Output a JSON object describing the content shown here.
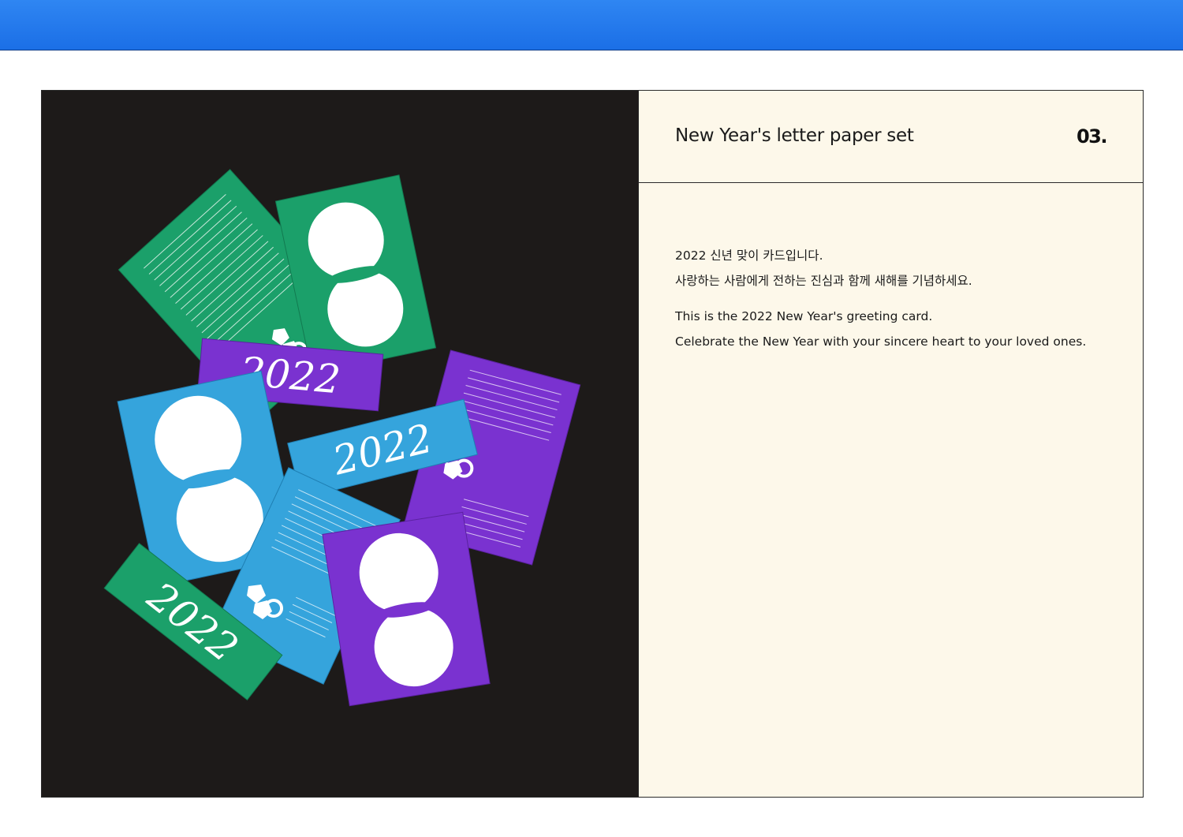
{
  "header": {
    "accent_color": "#2479ec"
  },
  "panel": {
    "title": "New Year's letter paper set",
    "number": "03.",
    "korean_lines": [
      "2022 신년 맞이 카드입니다.",
      "사랑하는 사람에게 전하는 진심과 함께 새해를 기념하세요."
    ],
    "english_lines": [
      "This is the 2022 New Year's greeting card.",
      "Celebrate the New Year with your sincere heart to your loved ones."
    ]
  },
  "photo": {
    "background": "#1d1a19",
    "card_colors": {
      "green": "#1ba06a",
      "blue": "#35a4dc",
      "purple": "#7a32d0"
    },
    "card_print": "2022"
  }
}
